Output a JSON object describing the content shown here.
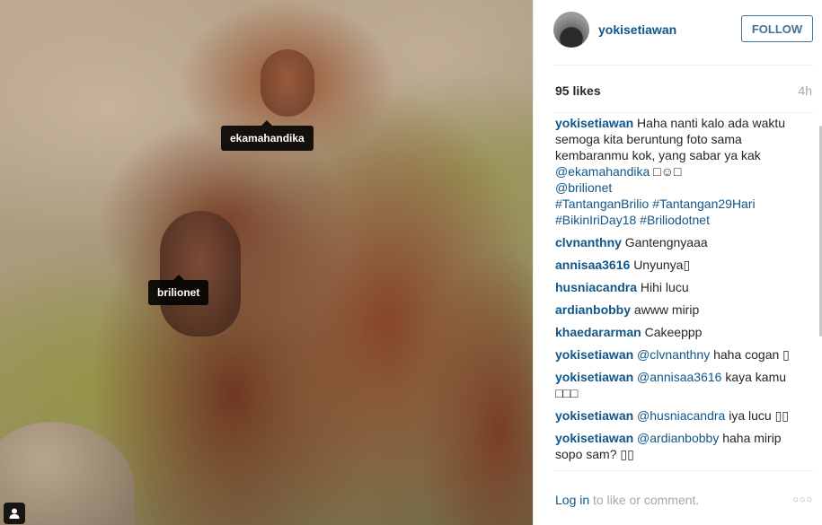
{
  "post": {
    "tags": [
      "ekamahandika",
      "brilionet"
    ]
  },
  "header": {
    "username": "yokisetiawan",
    "follow_label": "FOLLOW"
  },
  "meta": {
    "likes": "95 likes",
    "time": "4h"
  },
  "caption": {
    "user": "yokisetiawan",
    "text": "Haha nanti kalo ada waktu semoga kita beruntung foto sama kembaranmu kok, yang sabar ya kak",
    "mention1": "@ekamahandika",
    "emoji1": "□☺□",
    "mention2": "@brilionet",
    "hashtag1": "#TantanganBrilio",
    "hashtag2": "#Tantangan29Hari",
    "hashtag3": "#BikinIriDay18",
    "hashtag4": "#Briliodotnet"
  },
  "comments": [
    {
      "user": "clvnanthny",
      "mention": "",
      "text": "Gantengnyaaa"
    },
    {
      "user": "annisaa3616",
      "mention": "",
      "text": "Unyunya▯"
    },
    {
      "user": "husniacandra",
      "mention": "",
      "text": "Hihi lucu"
    },
    {
      "user": "ardianbobby",
      "mention": "",
      "text": "awww mirip"
    },
    {
      "user": "khaedararman",
      "mention": "",
      "text": "Cakeeppp"
    },
    {
      "user": "yokisetiawan",
      "mention": "@clvnanthny",
      "text": "haha cogan ▯"
    },
    {
      "user": "yokisetiawan",
      "mention": "@annisaa3616",
      "text": "kaya kamu □□□"
    },
    {
      "user": "yokisetiawan",
      "mention": "@husniacandra",
      "text": "iya lucu ▯▯"
    },
    {
      "user": "yokisetiawan",
      "mention": "@ardianbobby",
      "text": "haha mirip sopo sam? ▯▯"
    }
  ],
  "footer": {
    "login_link": "Log in",
    "login_rest": " to like or comment.",
    "more": "○○○"
  },
  "icons": {
    "user_tag_badge": "person-icon",
    "more_options": "ellipsis-icon"
  }
}
